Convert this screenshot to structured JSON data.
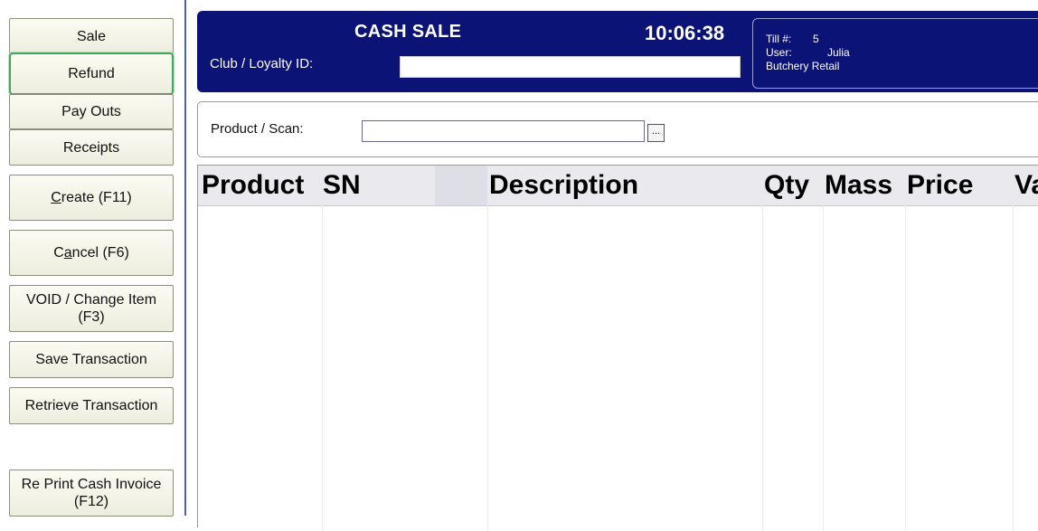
{
  "sidebar": {
    "sale": "Sale",
    "refund": "Refund",
    "pay_outs": "Pay Outs",
    "receipts": "Receipts",
    "create": {
      "pre": "",
      "mnemonic": "C",
      "post": "reate (F11)"
    },
    "cancel": {
      "pre": "C",
      "mnemonic": "a",
      "post": "ncel (F6)"
    },
    "void_change": "VOID / Change Item (F3)",
    "save_transaction": "Save Transaction",
    "retrieve_transaction": "Retrieve Transaction",
    "reprint_invoice": "Re Print Cash Invoice (F12)"
  },
  "header": {
    "title": "CASH SALE",
    "time": "10:06:38",
    "loyalty_label": "Club / Loyalty ID:",
    "loyalty_value": "",
    "till": {
      "till_label": "Till #:",
      "till_value": "5",
      "user_label": "User:",
      "user_value": "Julia",
      "department": "Butchery Retail"
    }
  },
  "scan": {
    "label": "Product / Scan:",
    "value": "",
    "browse_label": "..."
  },
  "grid": {
    "columns": [
      "Product",
      "SN",
      "Description",
      "Qty",
      "Mass",
      "Price",
      "Va"
    ]
  },
  "colors": {
    "header_bg": "#0b1377",
    "selected_border": "#3fa85a",
    "panel_border": "#4a64a8"
  }
}
